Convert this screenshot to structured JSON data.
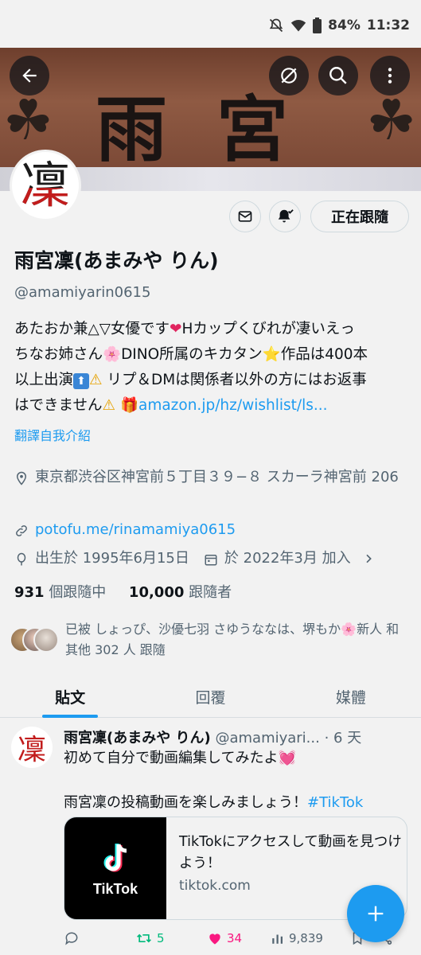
{
  "status_bar": {
    "battery": "84%",
    "time": "11:32"
  },
  "banner": {
    "text": [
      "雨",
      "宮"
    ]
  },
  "profile": {
    "avatar_char": "凜",
    "follow_button": "正在跟隨",
    "display_name": "雨宮凜(あまみや りん)",
    "handle": "@amamiyarin0615",
    "bio_lines": [
      {
        "a": "あたおか兼△▽女優です",
        "heart": "❤",
        "b": "Hカップくびれが凄いえっ"
      },
      {
        "a": "ちなお姉さん",
        "flower": "🌸",
        "b": "DINO所属のキカタン",
        "star": "⭐",
        "c": "作品は400本"
      },
      {
        "a": "以上出演",
        "up": "⬆",
        "warn": "⚠",
        "b": " リプ＆DMは関係者以外の方にはお返事"
      },
      {
        "a": "はできません",
        "warn": "⚠",
        "gift": "🎁",
        "link": "amazon.jp/hz/wishlist/ls..."
      }
    ],
    "translate_bio": "翻譯自我介紹",
    "location": "東京都渋谷区神宮前５丁目３９−８ スカーラ神宮前 206",
    "website": "potofu.me/rinamamiya0615",
    "birth": "出生於 1995年6月15日",
    "joined": "於 2022年3月 加入",
    "following_count": "931",
    "following_label": "個跟隨中",
    "followers_count": "10,000",
    "followers_label": "跟隨者",
    "followed_by": "已被 しょっぴ、沙優七羽 さゆうななは、堺もか🌸新人 和 其他 302 人 跟隨"
  },
  "tabs": [
    "貼文",
    "回覆",
    "媒體"
  ],
  "tweet": {
    "name": "雨宮凜(あまみや りん)",
    "handle": "@amamiyari...",
    "time": "· 6 天",
    "line1": "初めて自分で動画編集してみたよ💓",
    "line2": "雨宮凜の投稿動画を楽しみましょう！",
    "hashtag": "#TikTok",
    "card": {
      "thumb_label": "TikTok",
      "title": "TikTokにアクセスして動画を見つけよう！",
      "domain": "tiktok.com"
    },
    "retweets": "5",
    "likes": "34",
    "views": "9,839"
  },
  "colors": {
    "accent": "#1d9bf0",
    "like": "#f91880",
    "retweet": "#00ba7c",
    "background": "#f2f2f2"
  },
  "icons": [
    "back-arrow-icon",
    "translate-off-icon",
    "search-icon",
    "more-vertical-icon",
    "mail-icon",
    "bell-check-icon",
    "location-icon",
    "link-icon",
    "balloon-icon",
    "calendar-icon",
    "chevron-right-icon",
    "reply-icon",
    "retweet-icon",
    "heart-icon",
    "views-icon",
    "bookmark-icon",
    "share-icon",
    "plus-icon"
  ]
}
